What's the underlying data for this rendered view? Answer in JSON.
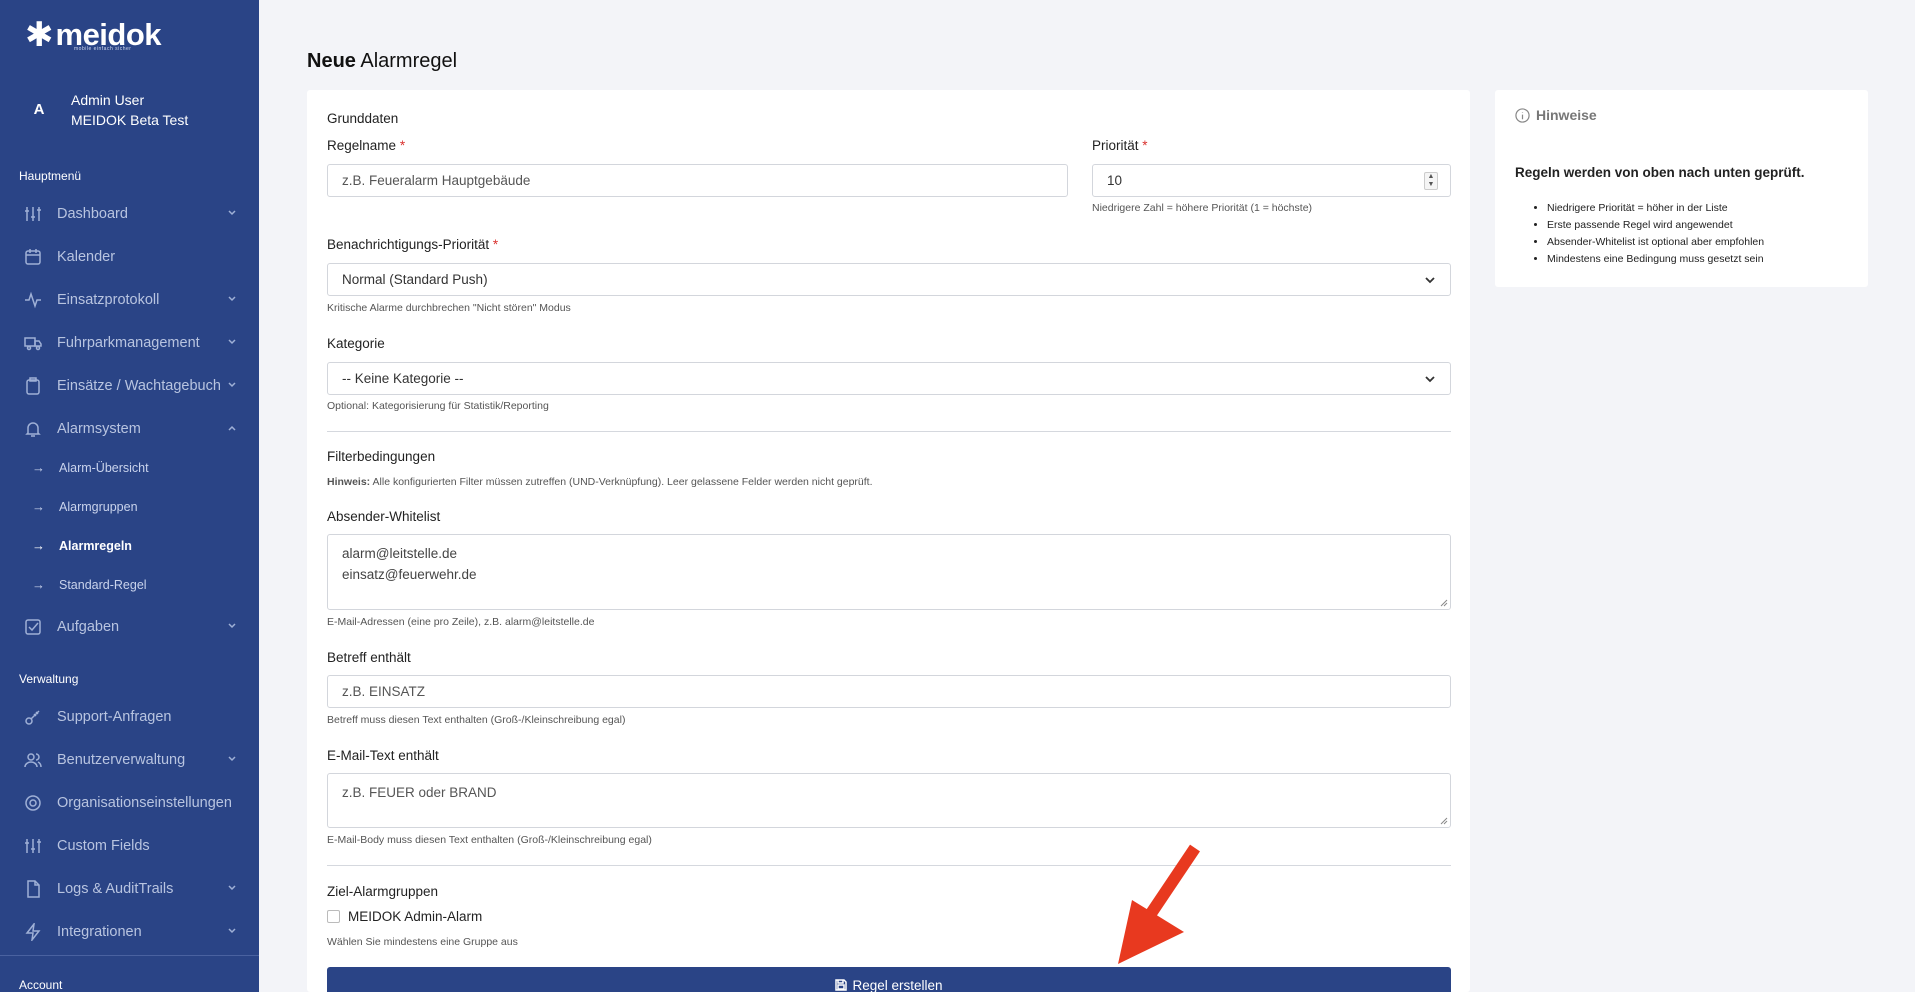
{
  "sidebar": {
    "logo_text": "meidok",
    "logo_sub": "mobile einfach sicher",
    "user": {
      "avatar_letter": "A",
      "name": "Admin User",
      "org": "MEIDOK Beta Test"
    },
    "section_main": "Hauptmenü",
    "section_admin": "Verwaltung",
    "items": [
      {
        "label": "Dashboard",
        "icon": "sliders-icon",
        "chevron": true
      },
      {
        "label": "Kalender",
        "icon": "calendar-icon",
        "chevron": false
      },
      {
        "label": "Einsatzprotokoll",
        "icon": "activity-icon",
        "chevron": true
      },
      {
        "label": "Fuhrparkmanagement",
        "icon": "truck-icon",
        "chevron": true
      },
      {
        "label": "Einsätze / Wachtagebuch",
        "icon": "clipboard-icon",
        "chevron": true
      },
      {
        "label": "Alarmsystem",
        "icon": "bell-icon",
        "chevron": true
      }
    ],
    "subitems": [
      {
        "label": "Alarm-Übersicht"
      },
      {
        "label": "Alarmgruppen"
      },
      {
        "label": "Alarmregeln"
      },
      {
        "label": "Standard-Regel"
      }
    ],
    "tasks": {
      "label": "Aufgaben",
      "icon": "check-square-icon"
    },
    "admin_items": [
      {
        "label": "Support-Anfragen",
        "icon": "key-icon",
        "chevron": false
      },
      {
        "label": "Benutzerverwaltung",
        "icon": "users-icon",
        "chevron": true
      },
      {
        "label": "Organisationseinstellungen",
        "icon": "gear-icon",
        "chevron": false
      },
      {
        "label": "Custom Fields",
        "icon": "sliders-icon",
        "chevron": false
      },
      {
        "label": "Logs & AuditTrails",
        "icon": "file-icon",
        "chevron": true
      },
      {
        "label": "Integrationen",
        "icon": "zap-icon",
        "chevron": true
      }
    ],
    "account_label": "Account"
  },
  "page": {
    "title_bold": "Neue",
    "title_rest": "Alarmregel"
  },
  "form": {
    "section_basic": "Grunddaten",
    "rule_name_label": "Regelname",
    "rule_name_placeholder": "z.B. Feueralarm Hauptgebäude",
    "priority_label": "Priorität",
    "priority_value": "10",
    "priority_help": "Niedrigere Zahl = höhere Priorität (1 = höchste)",
    "notify_label": "Benachrichtigungs-Priorität",
    "notify_value": "Normal (Standard Push)",
    "notify_help": "Kritische Alarme durchbrechen \"Nicht stören\" Modus",
    "category_label": "Kategorie",
    "category_value": "-- Keine Kategorie --",
    "category_help": "Optional: Kategorisierung für Statistik/Reporting",
    "section_filter": "Filterbedingungen",
    "filter_hint_bold": "Hinweis:",
    "filter_hint_text": "Alle konfigurierten Filter müssen zutreffen (UND-Verknüpfung). Leer gelassene Felder werden nicht geprüft.",
    "whitelist_label": "Absender-Whitelist",
    "whitelist_line1": "alarm@leitstelle.de",
    "whitelist_line2": "einsatz@feuerwehr.de",
    "whitelist_help": "E-Mail-Adressen (eine pro Zeile), z.B. alarm@leitstelle.de",
    "subject_label": "Betreff enthält",
    "subject_placeholder": "z.B. EINSATZ",
    "subject_help": "Betreff muss diesen Text enthalten (Groß-/Kleinschreibung egal)",
    "body_label": "E-Mail-Text enthält",
    "body_placeholder": "z.B. FEUER oder BRAND",
    "body_help": "E-Mail-Body muss diesen Text enthalten (Groß-/Kleinschreibung egal)",
    "section_groups": "Ziel-Alarmgruppen",
    "group_option": "MEIDOK Admin-Alarm",
    "group_help": "Wählen Sie mindestens eine Gruppe aus",
    "submit_label": "Regel erstellen",
    "required_mark": "*"
  },
  "hints": {
    "title": "Hinweise",
    "headline": "Regeln werden von oben nach unten geprüft.",
    "items": [
      "Niedrigere Priorität = höher in der Liste",
      "Erste passende Regel wird angewendet",
      "Absender-Whitelist ist optional aber empfohlen",
      "Mindestens eine Bedingung muss gesetzt sein"
    ]
  },
  "colors": {
    "sidebar": "#2a4486",
    "accent": "#2a4486",
    "required": "#d9322e",
    "annotation_arrow": "#e8391f"
  }
}
